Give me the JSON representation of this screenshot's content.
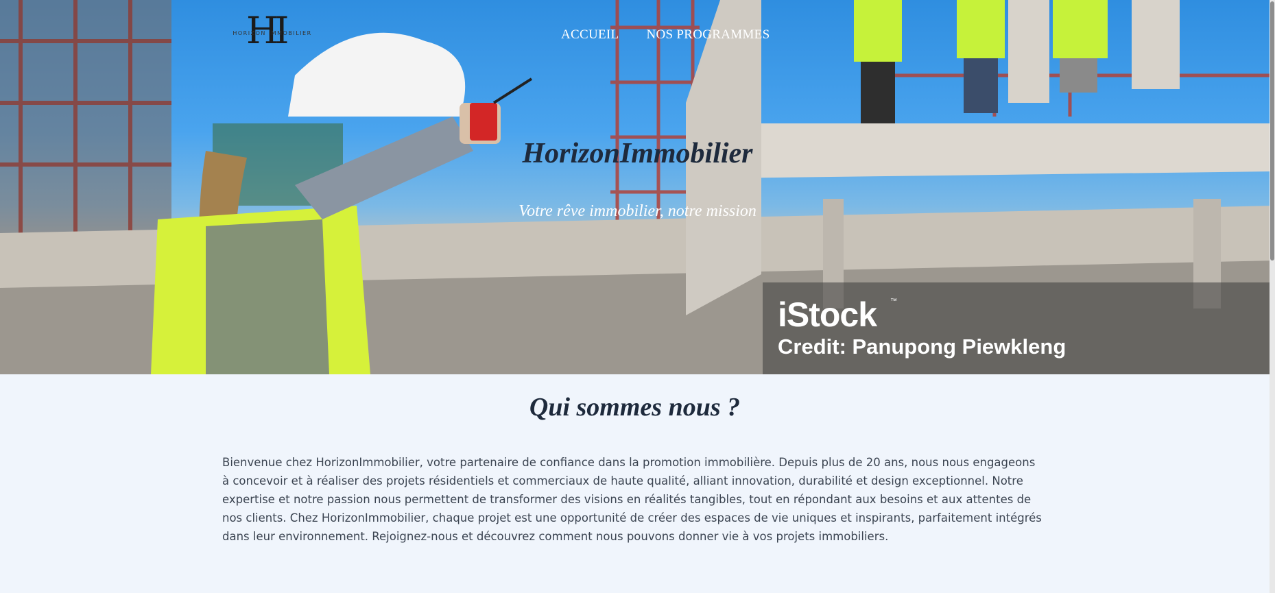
{
  "logo": {
    "mark": "HI",
    "text": "HORIZON IMMOBILIER"
  },
  "nav": {
    "items": [
      {
        "label": "ACCUEIL"
      },
      {
        "label": "NOS PROGRAMMES"
      }
    ]
  },
  "hero": {
    "title": "HorizonImmobilier",
    "subtitle": "Votre rêve immobilier, notre mission"
  },
  "watermark": {
    "brand": "iStock",
    "tm": "™",
    "credit": "Credit: Panupong Piewkleng"
  },
  "about": {
    "title": "Qui sommes nous ?",
    "text": "Bienvenue chez HorizonImmobilier, votre partenaire de confiance dans la promotion immobilière. Depuis plus de 20 ans, nous nous engageons à concevoir et à réaliser des projets résidentiels et commerciaux de haute qualité, alliant innovation, durabilité et design exceptionnel. Notre expertise et notre passion nous permettent de transformer des visions en réalités tangibles, tout en répondant aux besoins et aux attentes de nos clients. Chez HorizonImmobilier, chaque projet est une opportunité de créer des espaces de vie uniques et inspirants, parfaitement intégrés dans leur environnement. Rejoignez-nous et découvrez comment nous pouvons donner vie à vos projets immobiliers."
  },
  "colors": {
    "background": "#f0f5fc",
    "heading": "#1e2a3c",
    "text": "#3b4451",
    "sky": "#3a97e6"
  }
}
